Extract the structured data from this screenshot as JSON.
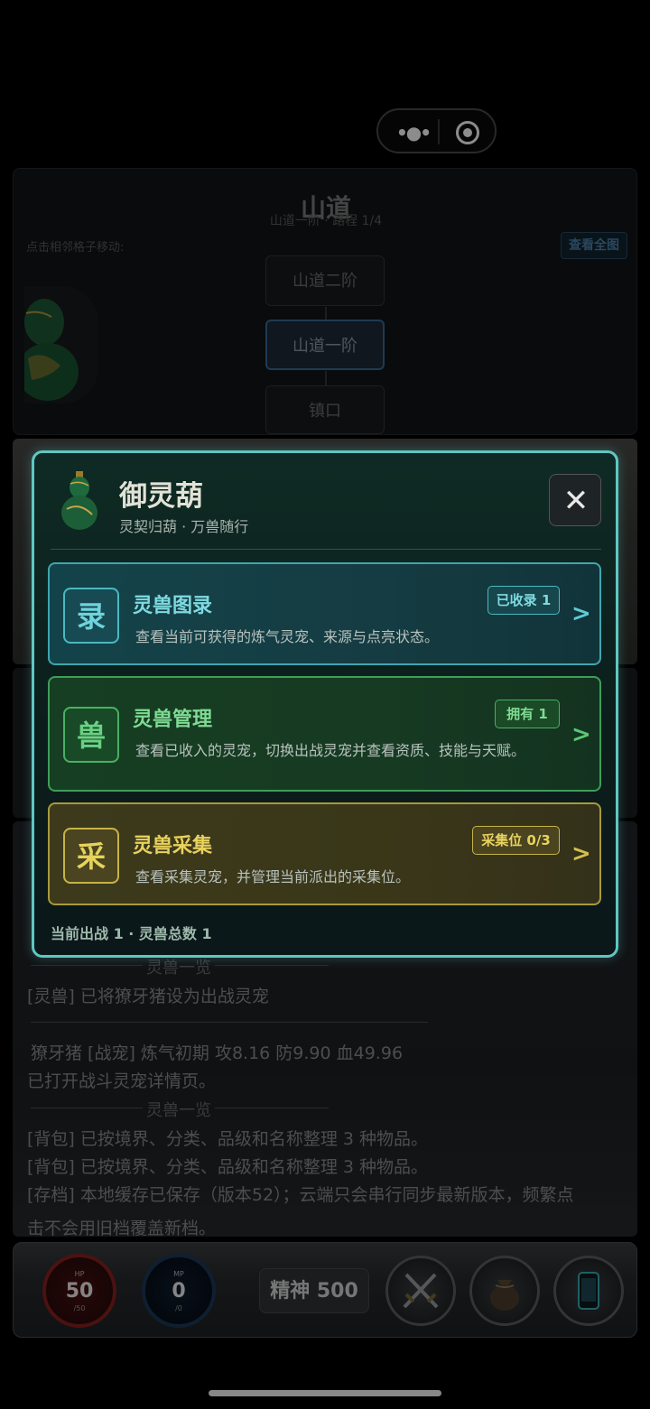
{
  "map": {
    "title": "山道",
    "subtitle": "山道一阶 · 路程 1/4",
    "hint": "点击相邻格子移动:",
    "view_full": "查看全图",
    "nodes": [
      "山道二阶",
      "山道一阶",
      "镇口"
    ]
  },
  "modal": {
    "title": "御灵葫",
    "subtitle": "灵契归葫 · 万兽随行",
    "close_symbol": "✕",
    "cards": [
      {
        "glyph": "录",
        "title": "灵兽图录",
        "badge": "已收录 1",
        "desc": "查看当前可获得的炼气灵宠、来源与点亮状态。",
        "arrow": ">"
      },
      {
        "glyph": "兽",
        "title": "灵兽管理",
        "badge": "拥有 1",
        "desc": "查看已收入的灵宠，切换出战灵宠并查看资质、技能与天赋。",
        "arrow": ">"
      },
      {
        "glyph": "采",
        "title": "灵兽采集",
        "badge": "采集位 0/3",
        "desc": "查看采集灵宠，并管理当前派出的采集位。",
        "arrow": ">"
      }
    ],
    "footer": "当前出战 1 · 灵兽总数 1"
  },
  "log": {
    "section_title_1": "灵兽一览",
    "line_1": "[灵兽] 已将獠牙猪设为出战灵宠",
    "line_2": "獠牙猪 [战宠] 炼气初期 攻8.16 防9.90 血49.96",
    "line_3": "已打开战斗灵宠详情页。",
    "section_title_2": "灵兽一览",
    "line_4": "[背包] 已按境界、分类、品级和名称整理 3 种物品。",
    "line_5": "[背包] 已按境界、分类、品级和名称整理 3 种物品。",
    "line_6": "[存档] 本地缓存已保存（版本52）；云端只会串行同步最新版本，频繁点",
    "line_7": "击不会用旧档覆盖新档。"
  },
  "bottombar": {
    "hp_label": "HP",
    "hp_value": "50",
    "hp_max": "/50",
    "mp_label": "MP",
    "mp_value": "0",
    "mp_max": "/0",
    "spirit": "精神 500"
  },
  "icons": {
    "more": "more-dots-icon",
    "capsule_close": "target-icon",
    "gourd": "gourd-icon",
    "battle": "crossed-swords-icon",
    "bag": "pouch-icon",
    "phone": "phone-icon"
  },
  "colors": {
    "modal_border": "#5fc7c2",
    "card_cyan": "#3fa6b0",
    "card_green": "#3e9f58",
    "card_gold": "#a89a3c",
    "hp": "#8a2020",
    "mp": "#1c3a5a"
  }
}
